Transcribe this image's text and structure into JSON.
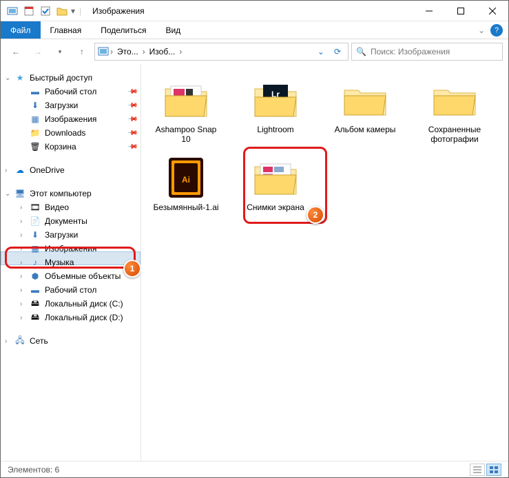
{
  "window": {
    "title": "Изображения"
  },
  "ribbon": {
    "file": "Файл",
    "tabs": [
      "Главная",
      "Поделиться",
      "Вид"
    ]
  },
  "address": {
    "crumbs": [
      "Это...",
      "Изоб..."
    ]
  },
  "search": {
    "placeholder": "Поиск: Изображения"
  },
  "sidebar": {
    "quick": {
      "label": "Быстрый доступ",
      "items": [
        {
          "label": "Рабочий стол",
          "pinned": true
        },
        {
          "label": "Загрузки",
          "pinned": true
        },
        {
          "label": "Изображения",
          "pinned": true
        },
        {
          "label": "Downloads",
          "pinned": true
        },
        {
          "label": "Корзина",
          "pinned": true
        }
      ]
    },
    "onedrive": {
      "label": "OneDrive"
    },
    "thispc": {
      "label": "Этот компьютер",
      "items": [
        {
          "label": "Видео"
        },
        {
          "label": "Документы"
        },
        {
          "label": "Загрузки"
        },
        {
          "label": "Изображения",
          "selected": true
        },
        {
          "label": "Музыка"
        },
        {
          "label": "Объемные объекты"
        },
        {
          "label": "Рабочий стол"
        },
        {
          "label": "Локальный диск (C:)"
        },
        {
          "label": "Локальный диск (D:)"
        }
      ]
    },
    "network": {
      "label": "Сеть"
    }
  },
  "items": [
    {
      "label": "Ashampoo Snap 10",
      "type": "folder-thumbs"
    },
    {
      "label": "Lightroom",
      "type": "folder-lr"
    },
    {
      "label": "Альбом камеры",
      "type": "folder"
    },
    {
      "label": "Сохраненные фотографии",
      "type": "folder"
    },
    {
      "label": "Безымянный-1.ai",
      "type": "ai"
    },
    {
      "label": "Снимки экрана",
      "type": "folder-thumbs"
    }
  ],
  "status": {
    "text": "Элементов: 6"
  },
  "annotations": {
    "badge1": "1",
    "badge2": "2"
  }
}
